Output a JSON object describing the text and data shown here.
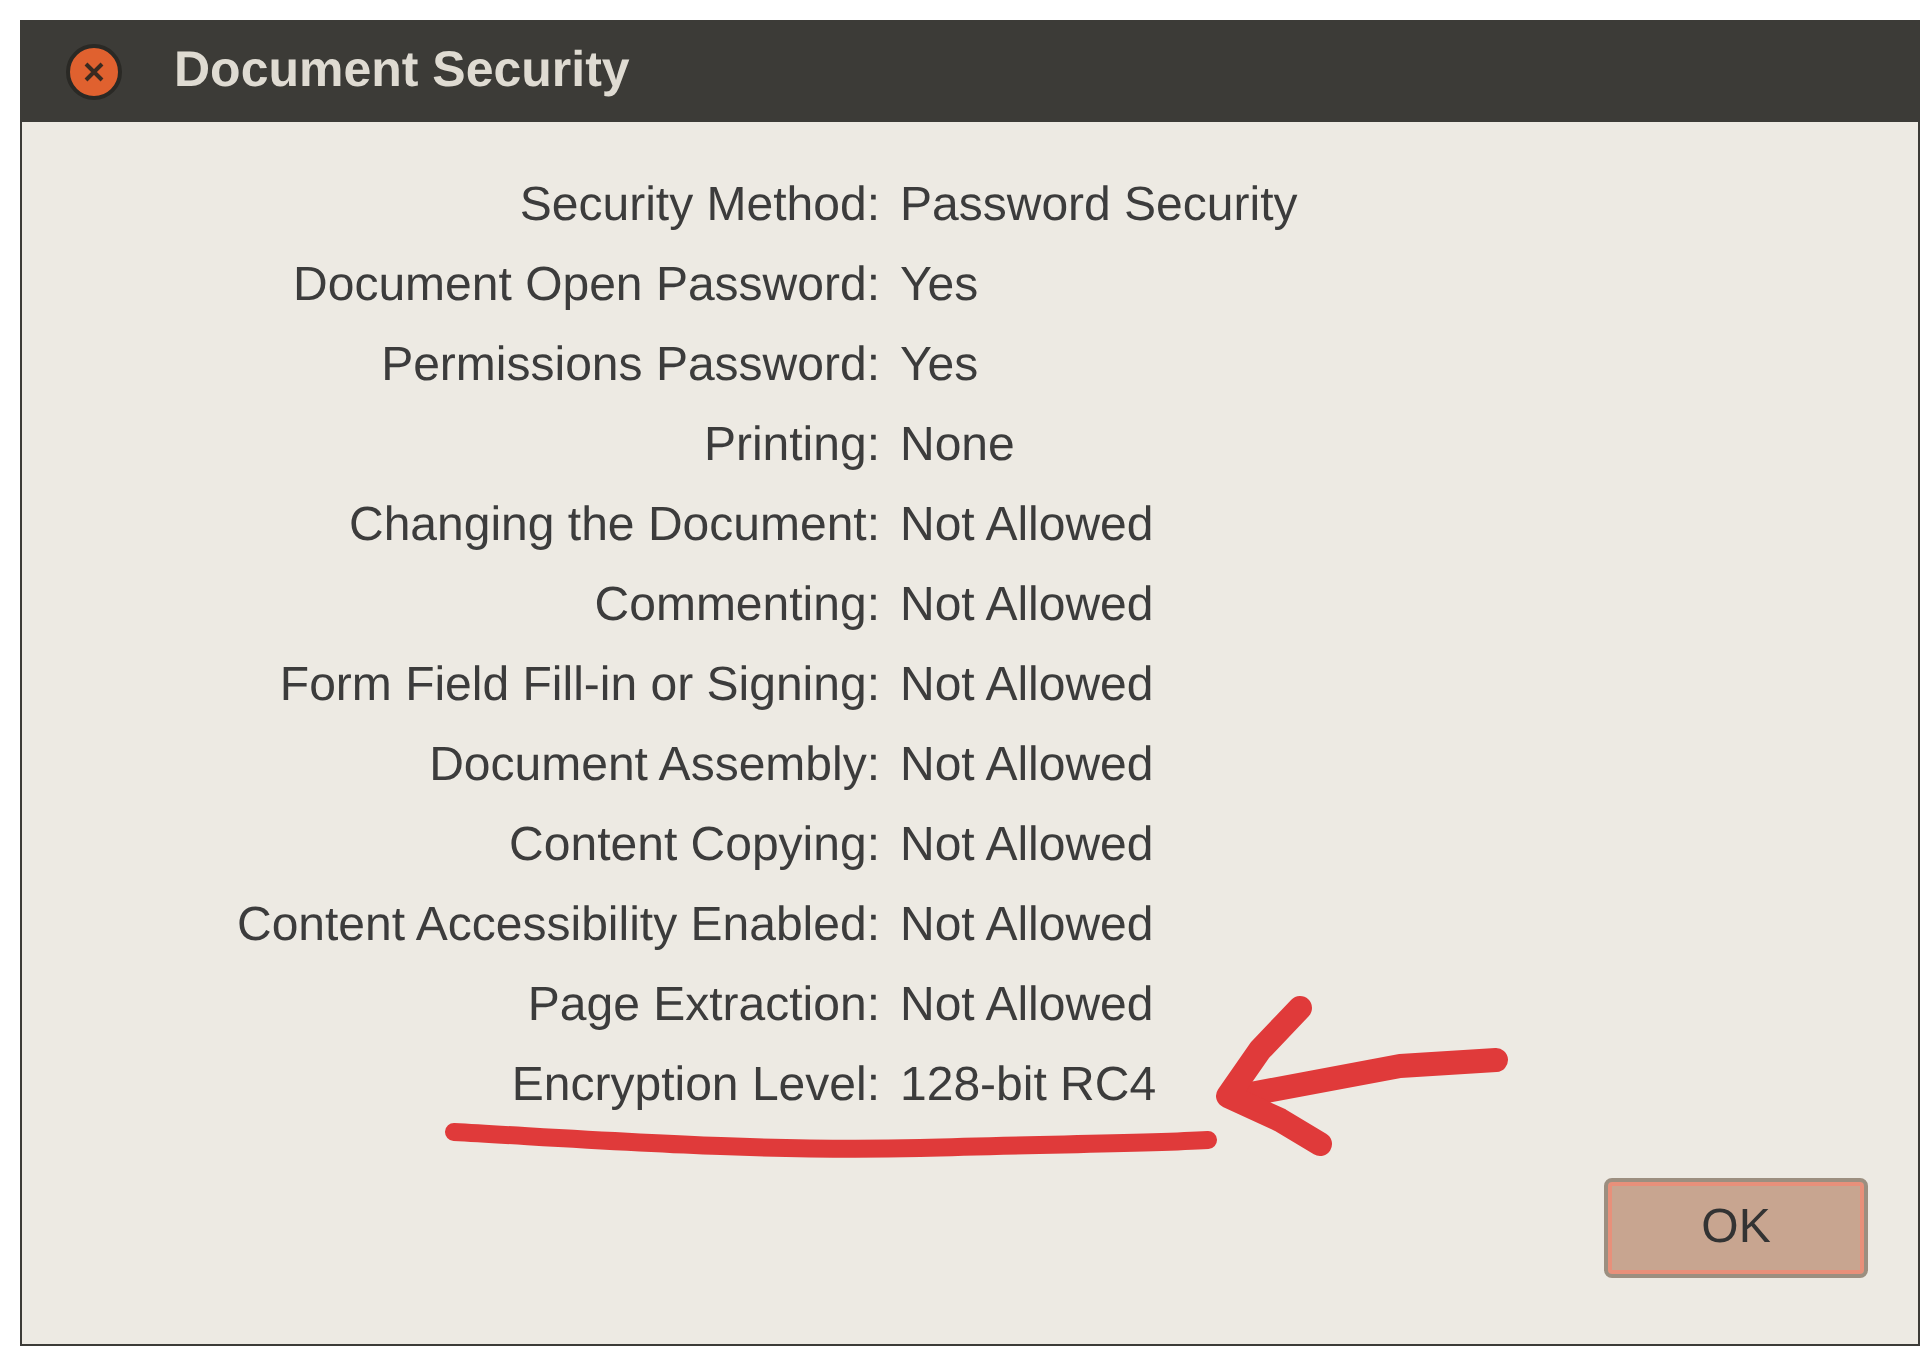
{
  "window": {
    "title": "Document Security"
  },
  "properties": [
    {
      "label": "Security Method:",
      "value": "Password Security"
    },
    {
      "label": "Document Open Password:",
      "value": "Yes"
    },
    {
      "label": "Permissions Password:",
      "value": "Yes"
    },
    {
      "label": "Printing:",
      "value": "None"
    },
    {
      "label": "Changing the Document:",
      "value": "Not Allowed"
    },
    {
      "label": "Commenting:",
      "value": "Not Allowed"
    },
    {
      "label": "Form Field Fill-in or Signing:",
      "value": "Not Allowed"
    },
    {
      "label": "Document Assembly:",
      "value": "Not Allowed"
    },
    {
      "label": "Content Copying:",
      "value": "Not Allowed"
    },
    {
      "label": "Content Accessibility Enabled:",
      "value": "Not Allowed"
    },
    {
      "label": "Page Extraction:",
      "value": "Not Allowed"
    },
    {
      "label": "Encryption Level:",
      "value": "128-bit RC4"
    }
  ],
  "buttons": [
    "OK"
  ]
}
